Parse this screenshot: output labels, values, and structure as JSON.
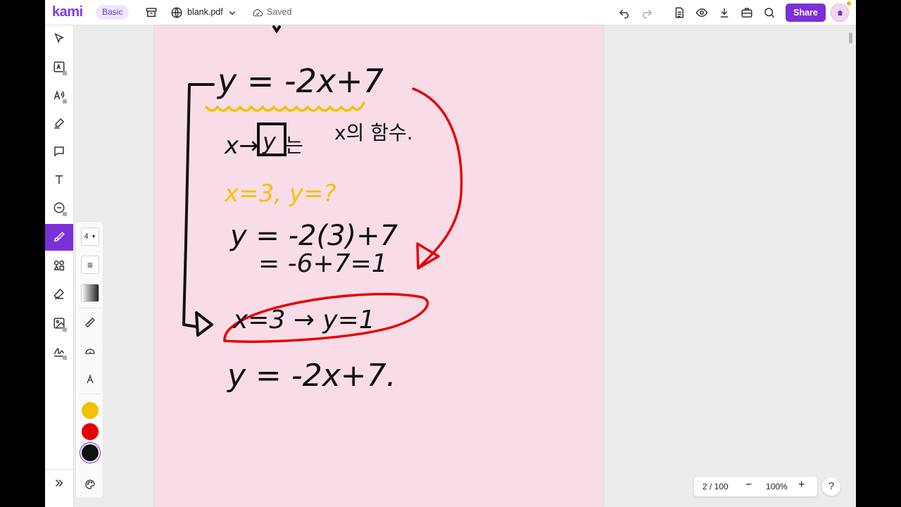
{
  "app": {
    "logo": "kami",
    "plan": "Basic",
    "file_name": "blank.pdf",
    "save_status": "Saved",
    "share_label": "Share",
    "avatar_icon": "home-icon"
  },
  "toolbar": {
    "icons": [
      "undo-icon",
      "redo-icon",
      "document-icon",
      "eye-icon",
      "download-icon",
      "toolbox-icon",
      "search-icon"
    ]
  },
  "left_toolbar": {
    "tools": [
      "select",
      "text-recognition",
      "text-to-speech",
      "highlighter",
      "comment",
      "text",
      "equation",
      "drawing",
      "shapes",
      "eraser",
      "image",
      "signature"
    ],
    "active": "drawing",
    "expand_icon": "double-chevron-right-icon"
  },
  "drawing_options": {
    "stroke_width": "4",
    "colors": [
      "#f2c200",
      "#e60000",
      "#111111"
    ],
    "selected_color": "#111111"
  },
  "document": {
    "background": "#f8dde9",
    "handwriting": {
      "line1": "y = -2x+7",
      "line2_a": "x→",
      "line2_box": "y",
      "line2_b": "는",
      "line2_c": "x의 함수.",
      "line3": "x=3, y=?",
      "line4": "y = -2(3)+7",
      "line5": "= -6+7=1",
      "line6": "x=3 → y=1",
      "line7": "y = -2x+7."
    }
  },
  "page_controls": {
    "page": "2 / 100",
    "zoom": "100%",
    "minus": "−",
    "plus": "+"
  },
  "help": "?"
}
